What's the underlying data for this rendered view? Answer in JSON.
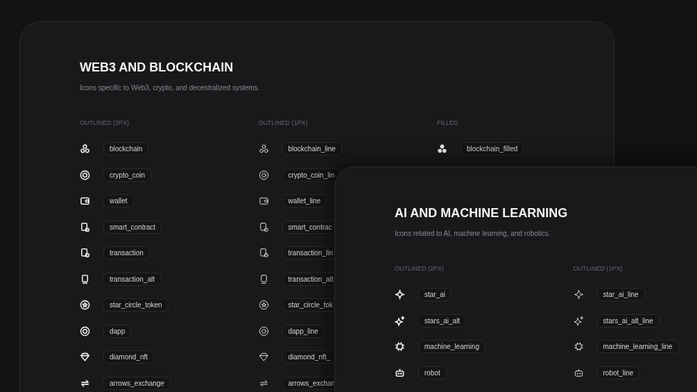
{
  "sections": [
    {
      "title": "WEB3 AND BLOCKCHAIN",
      "subtitle": "Icons specific to Web3, crypto, and decentralized systems.",
      "columns": [
        {
          "heading": "OUTLINED (2PX)",
          "kind": "bold",
          "items": [
            {
              "label": "blockchain"
            },
            {
              "label": "crypto_coin"
            },
            {
              "label": "wallet"
            },
            {
              "label": "smart_contract"
            },
            {
              "label": "transaction"
            },
            {
              "label": "transaction_alt"
            },
            {
              "label": "star_circle_token"
            },
            {
              "label": "dapp"
            },
            {
              "label": "diamond_nft"
            },
            {
              "label": "arrows_exchange"
            }
          ]
        },
        {
          "heading": "OUTLINED (1PX)",
          "kind": "thin",
          "items": [
            {
              "label": "blockchain_line"
            },
            {
              "label": "crypto_coin_lin"
            },
            {
              "label": "wallet_line"
            },
            {
              "label": "smart_contrac"
            },
            {
              "label": "transaction_lin"
            },
            {
              "label": "transaction_alt"
            },
            {
              "label": "star_circle_tok"
            },
            {
              "label": "dapp_line"
            },
            {
              "label": "diamond_nft_"
            },
            {
              "label": "arrows_exchan"
            }
          ]
        },
        {
          "heading": "FILLED",
          "kind": "filled",
          "items": [
            {
              "label": "blockchain_filled"
            }
          ]
        }
      ]
    },
    {
      "title": "AI AND MACHINE LEARNING",
      "subtitle": "Icons related to AI, machine learning, and robotics.",
      "columns": [
        {
          "heading": "OUTLINED (2PX)",
          "kind": "bold",
          "items": [
            {
              "label": "star_ai"
            },
            {
              "label": "stars_ai_alt"
            },
            {
              "label": "machine_learning"
            },
            {
              "label": "robot"
            }
          ]
        },
        {
          "heading": "OUTLINED (1PX)",
          "kind": "thin",
          "items": [
            {
              "label": "star_ai_line"
            },
            {
              "label": "stars_ai_alt_line"
            },
            {
              "label": "machine_learning_line"
            },
            {
              "label": "robot_line"
            }
          ]
        }
      ]
    }
  ]
}
